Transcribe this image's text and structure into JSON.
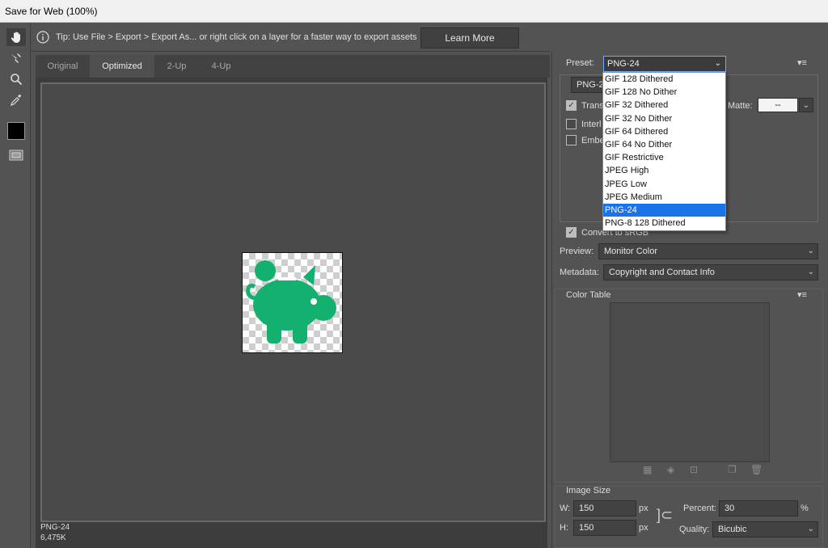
{
  "window": {
    "title": "Save for Web (100%)"
  },
  "tip": {
    "text": "Tip: Use File > Export > Export As...  or right click on a layer for a faster way to export assets",
    "button": "Learn More"
  },
  "tabs": [
    {
      "label": "Original",
      "active": false
    },
    {
      "label": "Optimized",
      "active": true
    },
    {
      "label": "2-Up",
      "active": false
    },
    {
      "label": "4-Up",
      "active": false
    }
  ],
  "preview": {
    "format": "PNG-24",
    "size": "6,475K",
    "image_color": "#14b06f"
  },
  "settings": {
    "preset_label": "Preset:",
    "preset_value": "PNG-24",
    "format_value": "PNG-24",
    "transparency_label": "Trans",
    "interlaced_label": "Interl",
    "embed_label": "Embe",
    "matte_label": "Matte:",
    "matte_value": "--",
    "convert_srgb_label": "Convert to sRGB",
    "preview_label": "Preview:",
    "preview_value": "Monitor Color",
    "metadata_label": "Metadata:",
    "metadata_value": "Copyright and Contact Info"
  },
  "preset_dropdown": {
    "items": [
      "GIF 128 Dithered",
      "GIF 128 No Dither",
      "GIF 32 Dithered",
      "GIF 32 No Dither",
      "GIF 64 Dithered",
      "GIF 64 No Dither",
      "GIF Restrictive",
      "JPEG High",
      "JPEG Low",
      "JPEG Medium",
      "PNG-24",
      "PNG-8 128 Dithered"
    ],
    "selected": "PNG-24"
  },
  "color_table": {
    "title": "Color Table"
  },
  "image_size": {
    "title": "Image Size",
    "w_label": "W:",
    "w_value": "150",
    "h_label": "H:",
    "h_value": "150",
    "unit": "px",
    "percent_label": "Percent:",
    "percent_value": "30",
    "percent_unit": "%",
    "quality_label": "Quality:",
    "quality_value": "Bicubic"
  }
}
